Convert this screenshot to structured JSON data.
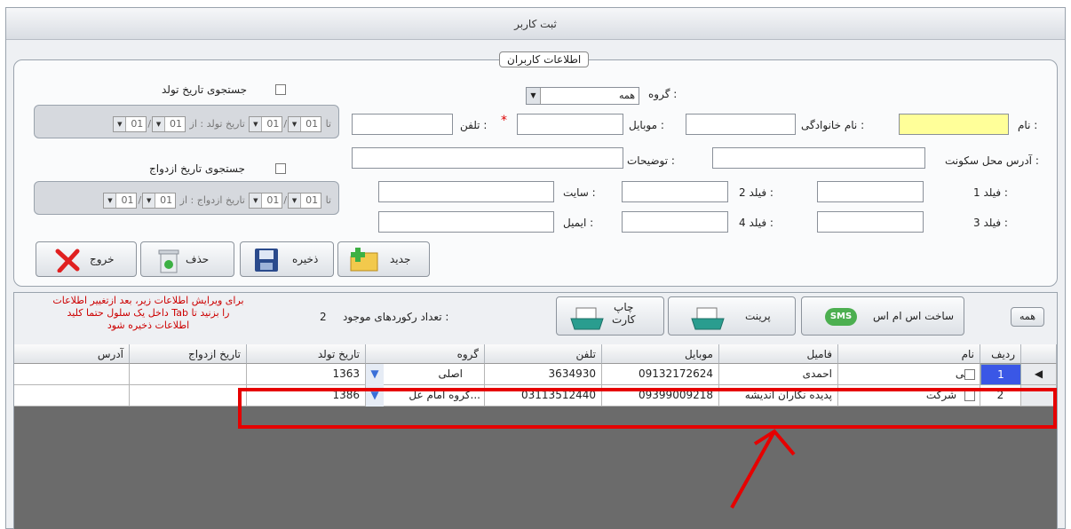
{
  "window": {
    "title": "ثبت کاربر"
  },
  "form": {
    "legend": "اطلاعات کاربران",
    "group_label": "گروه :",
    "group_value": "همه",
    "birth_search_label": "جستجوی تاریخ تولد",
    "marriage_search_label": "جستجوی تاریخ ازدواج",
    "birth_date_prefix": "تاریخ تولد : از",
    "marriage_date_prefix": "تاریخ ازدواج : از",
    "date_to": "تا",
    "date_part": "01",
    "date_sep": "/",
    "name_label": "نام :",
    "family_label": "نام خانوادگی :",
    "mobile_label": "موبایل :",
    "phone_label": "تلفن :",
    "required_mark": "*",
    "address_label": "آدرس محل سکونت :",
    "description_label": "توضیحات :",
    "field1_label": "فیلد 1 :",
    "field2_label": "فیلد 2 :",
    "field3_label": "فیلد 3 :",
    "field4_label": "فیلد 4 :",
    "site_label": "سایت :",
    "email_label": "ایمیل :"
  },
  "toolbar": {
    "new_label": "جدید",
    "save_label": "ذخیره",
    "delete_label": "حذف",
    "exit_label": "خروج"
  },
  "gridbar": {
    "all_label": "همه",
    "sms_label": "ساخت اس ام اس",
    "sms_badge": "SMS",
    "print_label": "پرینت",
    "print_card_label1": "چاپ",
    "print_card_label2": "کارت",
    "record_count_label": "تعداد رکوردهای موجود :",
    "record_count": "2",
    "note_line1": "برای ویرایش اطلاعات زیر، بعد ازتغییر اطلاعات",
    "note_line2": "داخل یک سلول حتما کلید Tab  را بزنید تا",
    "note_line3": "اطلاعات ذخیره شود"
  },
  "table": {
    "headers": {
      "row": "ردیف",
      "name": "نام",
      "family": "فامیل",
      "mobile": "موبایل",
      "phone": "تلفن",
      "group": "گروه",
      "birth": "تاریخ تولد",
      "marriage": "تاریخ ازدواج",
      "address": "آدرس"
    },
    "rows": [
      {
        "row": "1",
        "name": "علی",
        "family": "احمدی",
        "mobile": "09132172624",
        "phone": "3634930",
        "group": "اصلی",
        "birth": "1363",
        "marriage": "",
        "address": ""
      },
      {
        "row": "2",
        "name": "شرکت",
        "family": "پدیده نگاران اندیشه",
        "mobile": "09399009218",
        "phone": "03113512440",
        "group": "گروه امام عل...",
        "birth": "1386",
        "marriage": "",
        "address": ""
      }
    ]
  },
  "colors": {
    "highlight": "#e60000",
    "required_field": "#ffff99",
    "selected_row_num": "#3a57e6"
  }
}
